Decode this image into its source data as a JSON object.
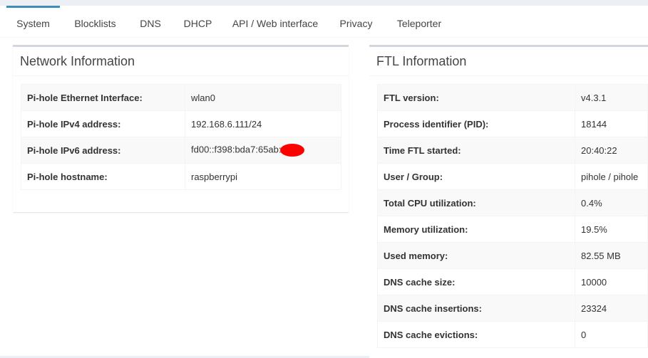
{
  "tabs": [
    "System",
    "Blocklists",
    "DNS",
    "DHCP",
    "API / Web interface",
    "Privacy",
    "Teleporter"
  ],
  "network": {
    "title": "Network Information",
    "rows": [
      {
        "label": "Pi-hole Ethernet Interface:",
        "value": "wlan0"
      },
      {
        "label": "Pi-hole IPv4 address:",
        "value": "192.168.6.111/24"
      },
      {
        "label": "Pi-hole IPv6 address:",
        "value": "fd00::f398:bda7:65ab:"
      },
      {
        "label": "Pi-hole hostname:",
        "value": "raspberrypi"
      }
    ]
  },
  "ftl": {
    "title": "FTL Information",
    "rows": [
      {
        "label": "FTL version:",
        "value": "v4.3.1"
      },
      {
        "label": "Process identifier (PID):",
        "value": "18144"
      },
      {
        "label": "Time FTL started:",
        "value": "20:40:22"
      },
      {
        "label": "User / Group:",
        "value": "pihole / pihole"
      },
      {
        "label": "Total CPU utilization:",
        "value": "0.4%"
      },
      {
        "label": "Memory utilization:",
        "value": "19.5%"
      },
      {
        "label": "Used memory:",
        "value": "82.55 MB"
      },
      {
        "label": "DNS cache size:",
        "value": "10000"
      },
      {
        "label": "DNS cache insertions:",
        "value": "23324"
      },
      {
        "label": "DNS cache evictions:",
        "value": "0"
      }
    ]
  },
  "colors": {
    "accent": "#3c8dbc",
    "redaction": "#ff0000"
  }
}
